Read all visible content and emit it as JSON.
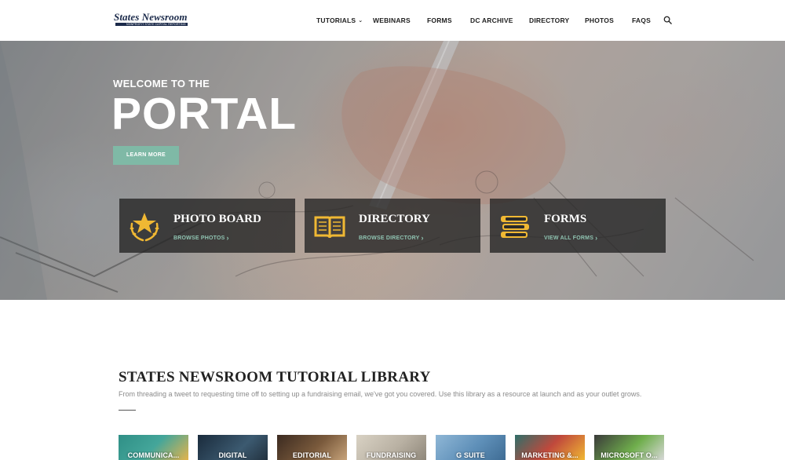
{
  "header": {
    "logo_name": "States Newsroom",
    "logo_tagline": "NONPROFIT STATE CAPITAL REPORTING",
    "nav": [
      "TUTORIALS",
      "WEBINARS",
      "FORMS",
      "DC ARCHIVE",
      "DIRECTORY",
      "PHOTOS",
      "FAQS"
    ],
    "search_icon": "search-icon"
  },
  "hero": {
    "eyebrow": "WELCOME TO THE",
    "title": "PORTAL",
    "button": "LEARN MORE",
    "button_color": "#7fb9a6",
    "cards": [
      {
        "title": "PHOTO BOARD",
        "link": "BROWSE PHOTOS",
        "icon": "star-laurel-icon"
      },
      {
        "title": "DIRECTORY",
        "link": "BROWSE DIRECTORY",
        "icon": "open-book-icon"
      },
      {
        "title": "FORMS",
        "link": "VIEW ALL FORMS",
        "icon": "book-stack-icon"
      }
    ],
    "icon_color": "#f0b833",
    "link_color": "#8fc3b1"
  },
  "library": {
    "title": "STATES NEWSROOM TUTORIAL LIBRARY",
    "description": "From threading a tweet to requesting time off to setting up a fundraising email, we've got you covered. Use this library as a resource at launch and as your outlet grows.",
    "tiles": [
      "COMMUNICA...",
      "DIGITAL",
      "EDITORIAL",
      "FUNDRAISING",
      "G SUITE",
      "MARKETING &...",
      "MICROSOFT O..."
    ]
  }
}
